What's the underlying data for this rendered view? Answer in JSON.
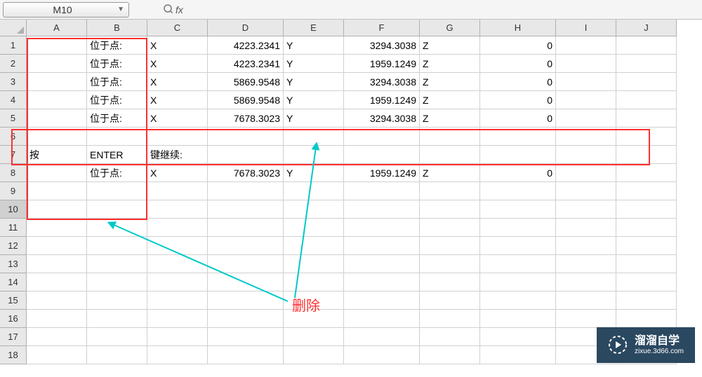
{
  "name_box": "M10",
  "fx_label": "fx",
  "columns": [
    "A",
    "B",
    "C",
    "D",
    "E",
    "F",
    "G",
    "H",
    "I",
    "J"
  ],
  "row_count": 18,
  "cells": {
    "r1": {
      "B": "位于点:",
      "C": "X",
      "D": "4223.2341",
      "E": "Y",
      "F": "3294.3038",
      "G": "Z",
      "H": "0"
    },
    "r2": {
      "B": "位于点:",
      "C": "X",
      "D": "4223.2341",
      "E": "Y",
      "F": "1959.1249",
      "G": "Z",
      "H": "0"
    },
    "r3": {
      "B": "位于点:",
      "C": "X",
      "D": "5869.9548",
      "E": "Y",
      "F": "3294.3038",
      "G": "Z",
      "H": "0"
    },
    "r4": {
      "B": "位于点:",
      "C": "X",
      "D": "5869.9548",
      "E": "Y",
      "F": "1959.1249",
      "G": "Z",
      "H": "0"
    },
    "r5": {
      "B": "位于点:",
      "C": "X",
      "D": "7678.3023",
      "E": "Y",
      "F": "3294.3038",
      "G": "Z",
      "H": "0"
    },
    "r7": {
      "A": "按",
      "B": "ENTER",
      "C": "键继续:"
    },
    "r8": {
      "B": "位于点:",
      "C": "X",
      "D": "7678.3023",
      "E": "Y",
      "F": "1959.1249",
      "G": "Z",
      "H": "0"
    }
  },
  "annotation": {
    "label": "删除"
  },
  "watermark": {
    "title": "溜溜自学",
    "url": "zixue.3d66.com"
  }
}
